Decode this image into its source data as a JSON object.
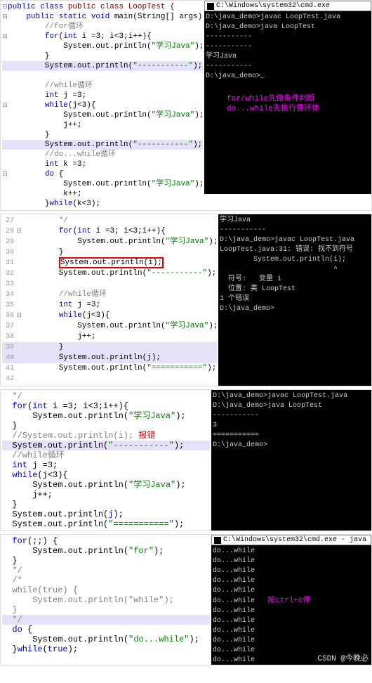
{
  "section1": {
    "title": "C:\\Windows\\system32\\cmd.exe",
    "code": {
      "l1": "public class LoopTest {",
      "l2": "    public static void main(String[] args) {",
      "l3": "        //for循环",
      "l4_a": "        for(int i =",
      "l4_b": "3",
      "l4_c": "; i<",
      "l4_d": "3",
      "l4_e": ";i++){",
      "l5": "            System.out.println(\"学习Java\");",
      "l6": "        }",
      "l7": "        System.out.println(\"-----------\");",
      "l8": "",
      "l9": "        //while循环",
      "l10_a": "        int j =",
      "l10_b": "3",
      "l11_a": "        while(j<",
      "l11_b": "3",
      "l11_c": "){",
      "l12": "            System.out.println(\"学习Java\");",
      "l13": "            j++;",
      "l14": "        }",
      "l15": "        System.out.println(\"-----------\");",
      "l16": "        //do...while循环",
      "l17_a": "        int k =",
      "l17_b": "3",
      "l18": "        do {",
      "l19": "            System.out.println(\"学习Java\");",
      "l20": "            k++;",
      "l21_a": "        }while(k<",
      "l21_b": "3",
      "l21_c": ");"
    },
    "console": {
      "c1": "D:\\java_demo>javac LoopTest.java",
      "c2": "",
      "c3": "D:\\java_demo>java LoopTest",
      "c4": "-----------",
      "c5": "-----------",
      "c6": "学习Java",
      "c7": "-----------",
      "c8": "D:\\java_demo>_"
    },
    "annot1": "for/while先做条件判断",
    "annot2": "do...while先执行循环体"
  },
  "section2": {
    "lines": {
      "n27": "27",
      "n28": "28",
      "n29": "29",
      "n30": "30",
      "n31": "31",
      "n32": "32",
      "n33": "33",
      "n34": "34",
      "n35": "35",
      "n36": "36",
      "n37": "37",
      "n38": "38",
      "n39": "39",
      "n40": "40",
      "n41": "41",
      "n42": "42"
    },
    "code": {
      "l27": "        */",
      "l28_a": "        for(int i =",
      "l28_b": "3",
      "l28_c": "; i<",
      "l28_d": "3",
      "l28_e": ";i++){",
      "l29": "            System.out.println(\"学习Java\");",
      "l30": "        }",
      "l31": "        System.out.println(i);",
      "l32": "        System.out.println(\"-----------\");",
      "l33": "",
      "l34": "        //while循环",
      "l35_a": "        int j =",
      "l35_b": "3",
      "l36_a": "        while(j<",
      "l36_b": "3",
      "l36_c": "){",
      "l37": "            System.out.println(\"学习Java\");",
      "l38": "            j++;",
      "l39": "        }",
      "l40": "        System.out.println(j);",
      "l41": "        System.out.println(\"===========\");",
      "l42": ""
    },
    "console": {
      "c1": "学习Java",
      "c2": "-----------",
      "c3": "D:\\java_demo>javac LoopTest.java",
      "c4": "LoopTest.java:31: 错误: 找不到符号",
      "c5": "        System.out.println(i);",
      "c6": "                           ^",
      "c7": "  符号:   变量 i",
      "c8": "  位置: 类 LoopTest",
      "c9": "1 个错误",
      "c10": "",
      "c11": "D:\\java_demo>"
    }
  },
  "section3": {
    "code": {
      "l1": "*/",
      "l2_a": "for(int i =",
      "l2_b": "3",
      "l2_c": "; i<",
      "l2_d": "3",
      "l2_e": ";i++){",
      "l3": "    System.out.println(\"学习Java\");",
      "l4": "}",
      "l5_a": "//System.out.println(i);",
      "l5_b": " 报错",
      "l6": "System.out.println(\"-----------\");",
      "l7": "",
      "l8": "//while循环",
      "l9_a": "int j =",
      "l9_b": "3",
      "l10_a": "while(j<",
      "l10_b": "3",
      "l10_c": "){",
      "l11": "    System.out.println(\"学习Java\");",
      "l12": "    j++;",
      "l13": "}",
      "l14": "System.out.println(j);",
      "l15": "System.out.println(\"===========\");"
    },
    "console": {
      "c1": "D:\\java_demo>javac LoopTest.java",
      "c2": "",
      "c3": "D:\\java_demo>java LoopTest",
      "c4": "-----------",
      "c5": "3",
      "c6": "===========",
      "c7": "",
      "c8": "D:\\java_demo>"
    }
  },
  "section4": {
    "title": "C:\\Windows\\system32\\cmd.exe - java",
    "code": {
      "l1": "for(;;) {",
      "l2": "    System.out.println(\"for\");",
      "l3": "}",
      "l4": "*/",
      "l5": "/*",
      "l6": "while(true) {",
      "l7": "    System.out.println(\"while\");",
      "l8": "}",
      "l9": "*/",
      "l10": "do {",
      "l11": "    System.out.println(\"do...while\");",
      "l12": "}while(true);"
    },
    "console_line": "do...while",
    "annot": "按ctrl+c停",
    "watermark": "CSDN @今晚必"
  }
}
